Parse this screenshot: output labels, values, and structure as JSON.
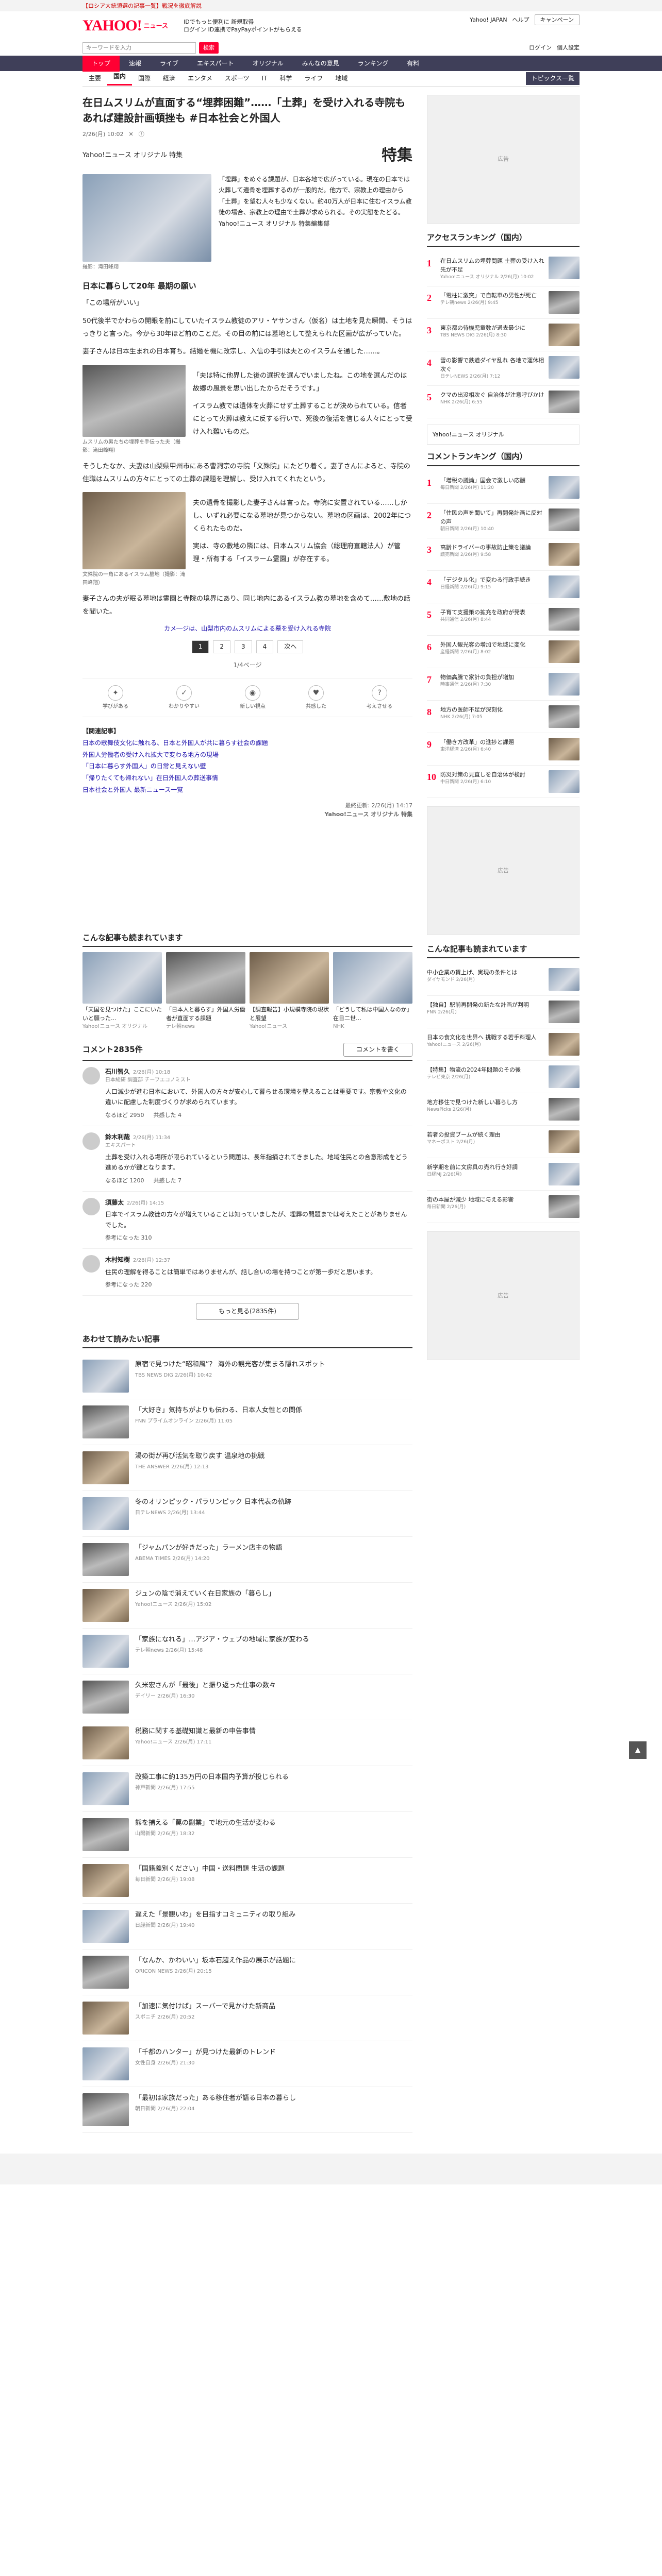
{
  "banner": "【ロシア大統領選の記事一覧】戦況を徹底解説",
  "header": {
    "logo": "YAHOO!",
    "logo_sub": "ニュース",
    "hdr_line1": "IDでもっと便利に 新規取得",
    "hdr_line2": "ログイン ID連携でPayPayポイントがもらえる",
    "links": [
      "Yahoo! JAPAN",
      "ヘルプ"
    ],
    "search_btn": "キャンペーン"
  },
  "search": {
    "placeholder": "キーワードを入力",
    "button": "検索",
    "right": [
      "ログイン",
      "個人設定"
    ]
  },
  "gnav": [
    "トップ",
    "速報",
    "ライブ",
    "エキスパート",
    "オリジナル",
    "みんなの意見",
    "ランキング",
    "有料"
  ],
  "snav": [
    "主要",
    "国内",
    "国際",
    "経済",
    "エンタメ",
    "スポーツ",
    "IT",
    "科学",
    "ライフ",
    "地域"
  ],
  "snav_more": "トピックス一覧",
  "article": {
    "title": "在日ムスリムが直面する“埋葬困難”……「土葬」を受け入れる寺院もあれば建設計画頓挫も #日本社会と外国人",
    "date": "2/26(月) 10:02",
    "tag": "Yahoo!ニュース オリジナル 特集",
    "tokushu": "特集",
    "caption1": "撮影：滝田峰翔",
    "lead": "「埋葬」をめぐる課題が、日本各地で広がっている。現在の日本では火葬して遺骨を埋葬するのが一般的だ。他方で、宗教上の理由から「土葬」を望む人々も少なくない。約40万人が日本に住むイスラム教徒の場合、宗教上の理由で土葬が求められる。その実態をたどる。",
    "lead_credit": "Yahoo!ニュース オリジナル 特集編集部",
    "h2": "日本に暮らして20年 最期の願い",
    "quote": "「この場所がいい」",
    "p1": "50代後半でかわらの開眼を前にしていたイスラム教徒のアリ・ヤサンさん（仮名）は土地を見た瞬間、そうはっきりと言った。今から30年ほど前のことだ。その目の前には墓地として整えられた区画が広がっていた。",
    "p2": "妻子さんは日本生まれの日本育ち。結婚を機に改宗し、入信の手引は夫とのイスラムを通した……。",
    "p3": "「夫は特に他界した後の選択を選んでいましたね。この地を選んだのは故郷の風景を思い出したからだそうです。」",
    "p4": "イスラム教では遺体を火葬にせず土葬することが決められている。信者にとって火葬は教えに反する行いで、死後の復活を信じる人々にとって受け入れ難いものだ。",
    "caption2": "ムスリムの男たちの埋葬を手伝った夫（撮影：滝田峰翔）",
    "p5": "そうしたなか、夫妻は山梨県甲州市にある曹洞宗の寺院「文殊院」にたどり着く。妻子さんによると、寺院の住職はムスリムの方々にとっての土葬の課題を理解し、受け入れてくれたという。",
    "p6": "夫の遺骨を撮影した妻子さんは言った。寺院に安置されている……しかし、いずれ必要になる墓地が見つからない。墓地の区画は、2002年につくられたものだ。",
    "caption3": "文殊院の一角にあるイスラム墓地（撮影：滝田峰翔）",
    "p7": "実は、寺の敷地の隣には、日本ムスリム協会（総理府直轄法人）が管理・所有する「イスラーム霊園」が存在する。",
    "p8": "妻子さんの夫が眠る墓地は霊園と寺院の境界にあり、同じ地内にあるイスラム教の墓地を含めて……敷地の話を聞いた。",
    "page_note": "カメ―ジは、山梨市内のムスリムによる墓を受け入れる寺院",
    "pages": [
      "1",
      "2",
      "3",
      "4",
      "次へ"
    ],
    "page_label": "1/4ページ",
    "reactions": [
      "学びがある",
      "わかりやすい",
      "新しい視点",
      "共感した",
      "考えさせる"
    ],
    "related_head": "【関連記事】",
    "related": [
      "日本の歌舞伎文化に触れる、日本と外国人が共に暮らす社会の課題",
      "外国人労働者の受け入れ拡大で変わる地方の現場",
      "「日本に暮らす外国人」の日常と見えない壁",
      "「帰りたくても帰れない」在日外国人の葬送事情",
      "日本社会と外国人 最新ニュース一覧"
    ],
    "credit_date": "最終更新: 2/26(月) 14:17",
    "credit": "Yahoo!ニュース オリジナル 特集"
  },
  "related_cards": {
    "title": "こんな記事も読まれています",
    "items": [
      {
        "t": "「天国を見つけた」ここにいたいと願った…",
        "s": "Yahoo!ニュース オリジナル"
      },
      {
        "t": "「日本人と暮らす」外国人労働者が直面する課題",
        "s": "テレ朝news"
      },
      {
        "t": "【調査報告】小規模寺院の現状と展望",
        "s": "Yahoo!ニュース"
      },
      {
        "t": "「どうして私は中国人なのか」在日二世…",
        "s": "NHK"
      }
    ]
  },
  "comments": {
    "title": "コメント2835件",
    "write": "コメントを書く",
    "items": [
      {
        "name": "石川智久",
        "time": "2/26(月) 10:18",
        "role": "日本総研 調査部 チーフエコノミスト",
        "txt": "人口減少が進む日本において、外国人の方々が安心して暮らせる環境を整えることは重要です。宗教や文化の違いに配慮した制度づくりが求められています。",
        "good": "なるほど 2950",
        "ok": "共感した 4"
      },
      {
        "name": "鈴木利哉",
        "time": "2/26(月) 11:34",
        "role": "エキスパート",
        "txt": "土葬を受け入れる場所が限られているという問題は、長年指摘されてきました。地域住民との合意形成をどう進めるかが鍵となります。",
        "good": "なるほど 1200",
        "ok": "共感した 7"
      },
      {
        "name": "須藤太",
        "time": "2/26(月) 14:15",
        "role": "",
        "txt": "日本でイスラム教徒の方々が増えていることは知っていましたが、埋葬の問題までは考えたことがありませんでした。",
        "good": "参考になった 310",
        "ok": ""
      },
      {
        "name": "木村知樹",
        "time": "2/26(月) 12:37",
        "role": "",
        "txt": "住民の理解を得ることは簡単ではありませんが、話し合いの場を持つことが第一歩だと思います。",
        "good": "参考になった 220",
        "ok": ""
      }
    ],
    "more": "もっと見る(2835件)"
  },
  "readlist": {
    "title": "あわせて読みたい記事",
    "items": [
      {
        "t": "原宿で見つけた“昭和風”？ 海外の観光客が集まる隠れスポット",
        "s": "TBS NEWS DIG 2/26(月) 10:42"
      },
      {
        "t": "「大好き」気持ちがよりも伝わる、日本人女性との関係",
        "s": "FNN プライムオンライン 2/26(月) 11:05"
      },
      {
        "t": "湯の街が再び活気を取り戻す 温泉地の挑戦",
        "s": "THE ANSWER 2/26(月) 12:13"
      },
      {
        "t": "冬のオリンピック・パラリンピック 日本代表の軌跡",
        "s": "日テレNEWS 2/26(月) 13:44"
      },
      {
        "t": "「ジャムパンが好きだった」ラーメン店主の物語",
        "s": "ABEMA TIMES 2/26(月) 14:20"
      },
      {
        "t": "ジュンの陰で消えていく在日家族の「暮らし」",
        "s": "Yahoo!ニュース 2/26(月) 15:02"
      },
      {
        "t": "「家族になれる」…アジア・ウェブの地域に家族が変わる",
        "s": "テレ朝news 2/26(月) 15:48"
      },
      {
        "t": "久米宏さんが「最後」と振り返った仕事の数々",
        "s": "デイリー 2/26(月) 16:30"
      },
      {
        "t": "税務に関する基礎知識と最新の申告事情",
        "s": "Yahoo!ニュース 2/26(月) 17:11"
      },
      {
        "t": "改築工事に約135万円の日本国内予算が投じられる",
        "s": "神戸新聞 2/26(月) 17:55"
      },
      {
        "t": "熊を捕える「罠の副業」で地元の生活が変わる",
        "s": "山陽新聞 2/26(月) 18:32"
      },
      {
        "t": "「国籍差別ください」中国・送料問題 生活の課題",
        "s": "毎日新聞 2/26(月) 19:08"
      },
      {
        "t": "遅えた「景観いわ」を目指すコミュニティの取り組み",
        "s": "日経新聞 2/26(月) 19:40"
      },
      {
        "t": "「なんか、かわいい」坂本石超え作品の展示が話題に",
        "s": "ORICON NEWS 2/26(月) 20:15"
      },
      {
        "t": "「加速に気付けば」スーパーで見かけた新商品",
        "s": "スポニチ 2/26(月) 20:52"
      },
      {
        "t": "「千都のハンター」が見つけた最新のトレンド",
        "s": "女性自身 2/26(月) 21:30"
      },
      {
        "t": "「最初は家族だった」ある移住者が語る日本の暮らし",
        "s": "朝日新聞 2/26(月) 22:04"
      }
    ]
  },
  "side": {
    "ranking_title": "アクセスランキング（国内）",
    "ranking": [
      {
        "n": "1",
        "t": "在日ムスリムの埋葬問題 土葬の受け入れ先が不足",
        "s": "Yahoo!ニュース オリジナル 2/26(月) 10:02"
      },
      {
        "n": "2",
        "t": "「電柱に激突」で自転車の男性が死亡",
        "s": "テレ朝news 2/26(月) 9:45"
      },
      {
        "n": "3",
        "t": "東京都の待機児童数が過去最少に",
        "s": "TBS NEWS DIG 2/26(月) 8:30"
      },
      {
        "n": "4",
        "t": "雪の影響で鉄道ダイヤ乱れ 各地で運休相次ぐ",
        "s": "日テレNEWS 2/26(月) 7:12"
      },
      {
        "n": "5",
        "t": "クマの出没相次ぐ 自治体が注意呼びかけ",
        "s": "NHK 2/26(月) 6:55"
      }
    ],
    "original_link": "Yahoo!ニュース オリジナル",
    "comment_rank_title": "コメントランキング（国内）",
    "comment_rank": [
      {
        "n": "1",
        "t": "「増税の議論」国会で激しい応酬",
        "s": "毎日新聞 2/26(月) 11:20"
      },
      {
        "n": "2",
        "t": "「住民の声を聞いて」再開発計画に反対の声",
        "s": "朝日新聞 2/26(月) 10:40"
      },
      {
        "n": "3",
        "t": "高齢ドライバーの事故防止策を議論",
        "s": "読売新聞 2/26(月) 9:58"
      },
      {
        "n": "4",
        "t": "「デジタル化」で変わる行政手続き",
        "s": "日経新聞 2/26(月) 9:15"
      },
      {
        "n": "5",
        "t": "子育て支援策の拡充を政府が発表",
        "s": "共同通信 2/26(月) 8:44"
      },
      {
        "n": "6",
        "t": "外国人観光客の増加で地域に変化",
        "s": "産経新聞 2/26(月) 8:02"
      },
      {
        "n": "7",
        "t": "物価高騰で家計の負担が増加",
        "s": "時事通信 2/26(月) 7:30"
      },
      {
        "n": "8",
        "t": "地方の医師不足が深刻化",
        "s": "NHK 2/26(月) 7:05"
      },
      {
        "n": "9",
        "t": "「働き方改革」の進捗と課題",
        "s": "東洋経済 2/26(月) 6:40"
      },
      {
        "n": "10",
        "t": "防災対策の見直しを自治体が検討",
        "s": "中日新聞 2/26(月) 6:10"
      }
    ],
    "ad": "広告",
    "topics_title": "こんな記事も読まれています",
    "topics": [
      {
        "t": "中小企業の賃上げ、実現の条件とは",
        "s": "ダイヤモンド 2/26(月)"
      },
      {
        "t": "【独自】駅前再開発の新たな計画が判明",
        "s": "FNN 2/26(月)"
      },
      {
        "t": "日本の食文化を世界へ 挑戦する若手料理人",
        "s": "Yahoo!ニュース 2/26(月)"
      },
      {
        "t": "【特集】物流の2024年問題のその後",
        "s": "テレビ東京 2/26(月)"
      },
      {
        "t": "地方移住で見つけた新しい暮らし方",
        "s": "NewsPicks 2/26(月)"
      },
      {
        "t": "若者の投資ブームが続く理由",
        "s": "マネーポスト 2/26(月)"
      },
      {
        "t": "新学期を前に文房具の売れ行き好調",
        "s": "日経MJ 2/26(月)"
      },
      {
        "t": "街の本屋が減少 地域に与える影響",
        "s": "毎日新聞 2/26(月)"
      }
    ]
  }
}
